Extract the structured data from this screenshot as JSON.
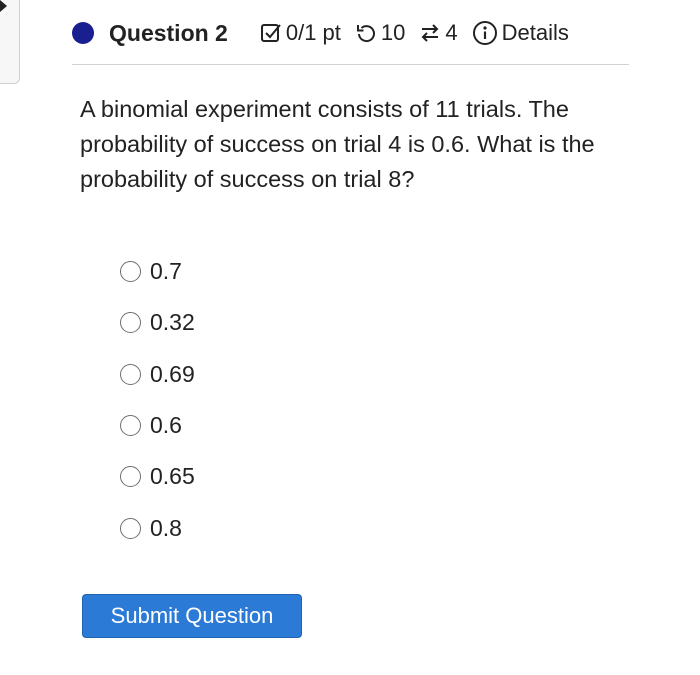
{
  "header": {
    "title": "Question 2",
    "score": "0/1 pt",
    "retries": "10",
    "attempts": "4",
    "details_label": "Details",
    "status_color": "#1a1f8f"
  },
  "question": {
    "text": "A binomial experiment consists of 11 trials. The probability of success on trial 4 is 0.6. What is the probability of success on trial 8?"
  },
  "options": [
    {
      "label": "0.7",
      "selected": false
    },
    {
      "label": "0.32",
      "selected": false
    },
    {
      "label": "0.69",
      "selected": false
    },
    {
      "label": "0.6",
      "selected": false
    },
    {
      "label": "0.65",
      "selected": false
    },
    {
      "label": "0.8",
      "selected": false
    }
  ],
  "submit": {
    "label": "Submit Question",
    "color": "#2a7ad6"
  },
  "icons": [
    "caret-right-icon",
    "status-dot-icon",
    "checkbox-score-icon",
    "retry-icon",
    "attempts-icon",
    "info-icon"
  ]
}
